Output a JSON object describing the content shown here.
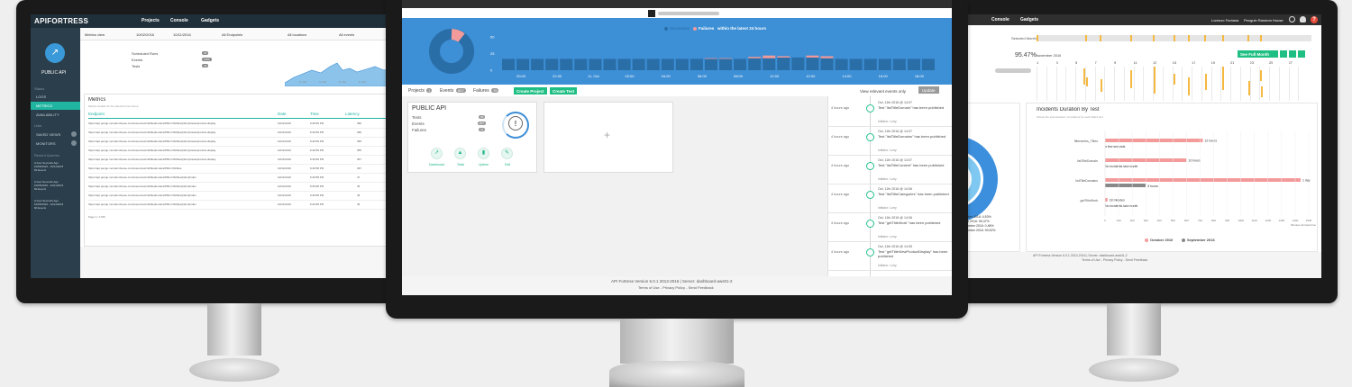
{
  "left": {
    "brand": "APIFORTRESS",
    "nav": [
      "Projects",
      "Console",
      "Gadgets"
    ],
    "project": "PUBLIC API",
    "sidebar": {
      "status": "Status",
      "logs": "LOGS",
      "metrics": "METRICS",
      "availability": "AVAILABILITY",
      "lists": "Lists",
      "saved": "SAVED VIEWS",
      "monitors": "MONITORS",
      "recent": "Recent Queries"
    },
    "recent_queries": [
      {
        "line1": "A Few Seconds Ago",
        "line2": "10/05/2016 - 10/11/2016",
        "line3": "60 Events"
      },
      {
        "line1": "A Few Seconds Ago",
        "line2": "10/05/2016 - 10/11/2016",
        "line3": "60 Events"
      },
      {
        "line1": "A Few Seconds Ago",
        "line2": "10/05/2016 - 10/11/2016",
        "line3": "60 Events"
      }
    ],
    "filters": {
      "view": "Metrics view",
      "from": "10/02/2016",
      "to": "10/11/2016",
      "endpoints": "All Endpoints",
      "locations": "All locations",
      "events": "All events"
    },
    "summary": [
      {
        "label": "Scheduled Runs",
        "value": "30"
      },
      {
        "label": "Events",
        "value": "1565"
      },
      {
        "label": "Tests",
        "value": "30"
      }
    ],
    "spark_ticks": [
      "2. Oct",
      "4. Oct",
      "5. Oct",
      "6. Oct"
    ],
    "metrics_title": "Metrics",
    "metrics_sub": "Metrics details for the selected time frame",
    "table_headers": {
      "endpoint": "Endpoint",
      "date": "Date",
      "time": "Time",
      "latency": "Latency"
    },
    "rows": [
      {
        "url": "https://api.pengu.mondomhouse.com/resources/v2/titledomains/PRH.US/titles/{isbn}/views/product-display",
        "date": "10/11/2016",
        "time": "6:29:59 PM",
        "lat": "390"
      },
      {
        "url": "https://api.pengu.mondomhouse.com/resources/v2/titledomains/PRH.US/titles/{isbn}/views/product-display",
        "date": "10/11/2016",
        "time": "6:29:59 PM",
        "lat": "396"
      },
      {
        "url": "https://api.pengu.mondomhouse.com/resources/v2/titledomains/PRH.US/titles/{isbn}/views/product-display",
        "date": "10/11/2016",
        "time": "6:29:59 PM",
        "lat": "395"
      },
      {
        "url": "https://api.pengu.mondomhouse.com/resources/v2/titledomains/PRH.US/titles/{isbn}/views/product-display",
        "date": "10/11/2016",
        "time": "6:29:59 PM",
        "lat": "355"
      },
      {
        "url": "https://api.pengu.mondomhouse.com/resources/v2/titledomains/PRH.US/titles/{isbn}/views/product-display",
        "date": "10/11/2016",
        "time": "6:29:59 PM",
        "lat": "367"
      },
      {
        "url": "https://api.pengu.mondomhouse.com/resources/v2/titledomains/PRH.US/titles",
        "date": "10/11/2016",
        "time": "6:29:58 PM",
        "lat": "397"
      },
      {
        "url": "https://api.pengu.mondomhouse.com/resources/v2/titledomains/PRH.US/titles/{isbn}/index",
        "date": "10/11/2016",
        "time": "6:29:58 PM",
        "lat": "47"
      },
      {
        "url": "https://api.pengu.mondomhouse.com/resources/v2/titledomains/PRH.US/titles/{isbn}/index",
        "date": "10/11/2016",
        "time": "6:29:58 PM",
        "lat": "45"
      },
      {
        "url": "https://api.pengu.mondomhouse.com/resources/v2/titledomains/PRH.US/titles/{isbn}/index",
        "date": "10/11/2016",
        "time": "6:29:58 PM",
        "lat": "46"
      },
      {
        "url": "https://api.pengu.mondomhouse.com/resources/v2/titledomains/PRH.US/titles/{isbn}/index",
        "date": "10/11/2016",
        "time": "6:29:58 PM",
        "lat": "46"
      }
    ],
    "pager": "Page 1 / 1766"
  },
  "center": {
    "legend_success": "Successes",
    "legend_fail": "Failures",
    "legend_tail": "within the latest 24 hours",
    "y_ticks": [
      "50",
      "25",
      "0"
    ],
    "x_ticks": [
      "20:00",
      "22:00",
      "11. Oct",
      "02:00",
      "04:00",
      "06:00",
      "08:00",
      "10:00",
      "12:00",
      "14:00",
      "16:00",
      "18:00"
    ],
    "chart_data": {
      "type": "bar",
      "title": "",
      "ylim": [
        0,
        50
      ],
      "series": [
        {
          "name": "Successes",
          "values": [
            17,
            17,
            17,
            17,
            17,
            17,
            17,
            17,
            17,
            17,
            17,
            17,
            17,
            17,
            17,
            17,
            17,
            18,
            18,
            19,
            19,
            19,
            18,
            17,
            17,
            17,
            17,
            17,
            17,
            17
          ]
        },
        {
          "name": "Failures",
          "values": [
            0,
            0,
            0,
            0,
            0,
            0,
            0,
            0,
            0,
            0,
            0,
            0,
            0,
            0,
            1,
            1,
            0,
            2,
            4,
            2,
            0,
            3,
            3,
            0,
            0,
            0,
            0,
            0,
            0,
            0
          ]
        }
      ]
    },
    "counters": {
      "projects_label": "Projects",
      "projects": "1",
      "events_label": "Events",
      "events": "807",
      "failures_label": "Failures",
      "failures": "76"
    },
    "buttons": {
      "create_project": "Create Project",
      "create_test": "Create Test",
      "view": "View relevant events only",
      "update": "Update"
    },
    "project": {
      "name": "PUBLIC API",
      "tests_label": "Tests",
      "tests": "30",
      "events_label": "Events",
      "events": "807",
      "failures_label": "Failures",
      "failures": "76"
    },
    "actions": [
      "Dashboard",
      "Tests",
      "Uptime",
      "Edit"
    ],
    "add_symbol": "+",
    "feed": [
      {
        "ago": "4 hours ago",
        "date": "Oct, 11th 2016 @ 14:07",
        "text": "Test \"listTitleDomain\" has been published",
        "by": "Initiator: Lorry"
      },
      {
        "ago": "4 hours ago",
        "date": "Oct, 11th 2016 @ 14:07",
        "text": "Test \"listTitleDomains\" has been published",
        "by": "Initiator: Lorry"
      },
      {
        "ago": "4 hours ago",
        "date": "Oct, 11th 2016 @ 14:07",
        "text": "Test \"listTitleContent\" has been published",
        "by": "Initiator: Lorry"
      },
      {
        "ago": "4 hours ago",
        "date": "Oct, 11th 2016 @ 14:06",
        "text": "Test \"listTitleCategories\" has been published",
        "by": "Initiator: Lorry"
      },
      {
        "ago": "4 hours ago",
        "date": "Oct, 11th 2016 @ 14:06",
        "text": "Test \"getTitleWork\" has been published",
        "by": "Initiator: Lorry"
      },
      {
        "ago": "4 hours ago",
        "date": "Oct, 11th 2016 @ 14:05",
        "text": "Test \"getTitleViewProductDisplay\" has been published",
        "by": "Initiator: Lorry"
      }
    ],
    "footer1": "API Fortress Version 6.0.1 2013-2016 | Server: dashboard-aws01-2",
    "footer2": "Terms of Use - Privacy Policy - Send Feedback"
  },
  "right": {
    "nav": [
      "Console",
      "Gadgets"
    ],
    "user": "Lorenzo Fontana",
    "company": "Penguin Random House",
    "selected_month": "Selected Month",
    "pct": "95.47%",
    "month": "November 2016",
    "days": [
      "1",
      "3",
      "5",
      "7",
      "9",
      "11",
      "13",
      "15",
      "17",
      "19",
      "21",
      "23",
      "25",
      "27"
    ],
    "see_full": "See Full Month",
    "donut_lines": [
      "ber 2016: 4.53%",
      "r 2016: 95.47%",
      "mber 2016: 0.48%",
      "mber 2016: 99.52%"
    ],
    "inc_title": "Incidents Duration By Test",
    "inc_sub": "Shows the total duration of incidents for each failed test",
    "chart_data": {
      "type": "bar",
      "orientation": "horizontal",
      "title": "Incidents Duration By Test",
      "categories": [
        "filterseries_Titles",
        "listTitleDomain",
        "listTitleDomains",
        "getTitleWork"
      ],
      "x_ticks": [
        "0",
        "100",
        "200",
        "300",
        "400",
        "500",
        "600",
        "700",
        "800",
        "900",
        "1000",
        "1100",
        "1200",
        "1300",
        "1400",
        "1500"
      ],
      "xlabel": "Minutes all downtime",
      "series": [
        {
          "name": "October 2016",
          "values": [
            720,
            600,
            1440,
            18
          ],
          "labels": [
            "12 hours",
            "10 hours",
            "1 day",
            "18 minutes"
          ]
        },
        {
          "name": "September 2016",
          "values": [
            0.05,
            0,
            300,
            0
          ],
          "labels": [
            "a few seconds",
            "No incidents last month",
            "5 hours",
            "No incidents last month"
          ]
        }
      ]
    },
    "legend": [
      "October 2016",
      "September 2016"
    ],
    "footer1": "API Fortress Version 6.0.1 2013-2016 | Server: dashboard-aws01-2",
    "footer2": "Terms of Use - Privacy Policy - Send Feedback"
  },
  "colors": {
    "teal": "#1fb5a1",
    "blue": "#3d8fd6",
    "pink": "#f39a9a",
    "green": "#1fbf83",
    "dark": "#2b3e4b"
  }
}
